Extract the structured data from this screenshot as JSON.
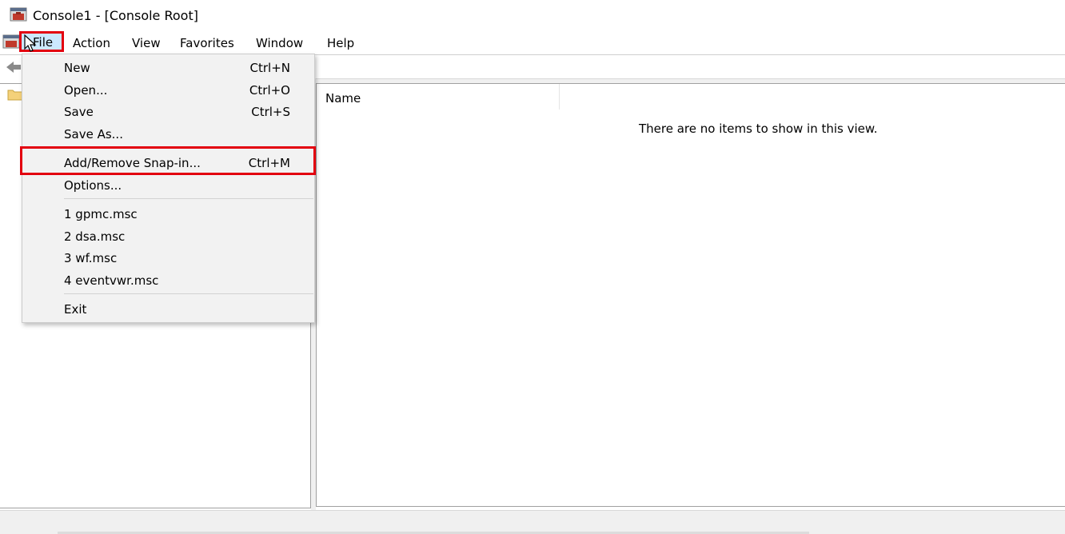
{
  "window": {
    "title": "Console1 - [Console Root]"
  },
  "menubar": {
    "file": "File",
    "action": "Action",
    "view": "View",
    "favorites": "Favorites",
    "window": "Window",
    "help": "Help"
  },
  "file_menu": {
    "new": {
      "label": "New",
      "shortcut": "Ctrl+N"
    },
    "open": {
      "label": "Open...",
      "shortcut": "Ctrl+O"
    },
    "save": {
      "label": "Save",
      "shortcut": "Ctrl+S"
    },
    "save_as": {
      "label": "Save As..."
    },
    "add_remove": {
      "label": "Add/Remove Snap-in...",
      "shortcut": "Ctrl+M"
    },
    "options": {
      "label": "Options..."
    },
    "recent": [
      "1 gpmc.msc",
      "2 dsa.msc",
      "3 wf.msc",
      "4 eventvwr.msc"
    ],
    "exit": {
      "label": "Exit"
    }
  },
  "right_pane": {
    "column_name": "Name",
    "empty_message": "There are no items to show in this view."
  },
  "colors": {
    "highlight": "#e3000f",
    "menu_bg": "#f2f2f2",
    "selected_menu": "#cce8ff"
  },
  "icons": {
    "app": "mmc-console-icon",
    "back": "back-arrow-icon",
    "folder": "folder-icon",
    "cursor": "mouse-pointer-icon"
  }
}
